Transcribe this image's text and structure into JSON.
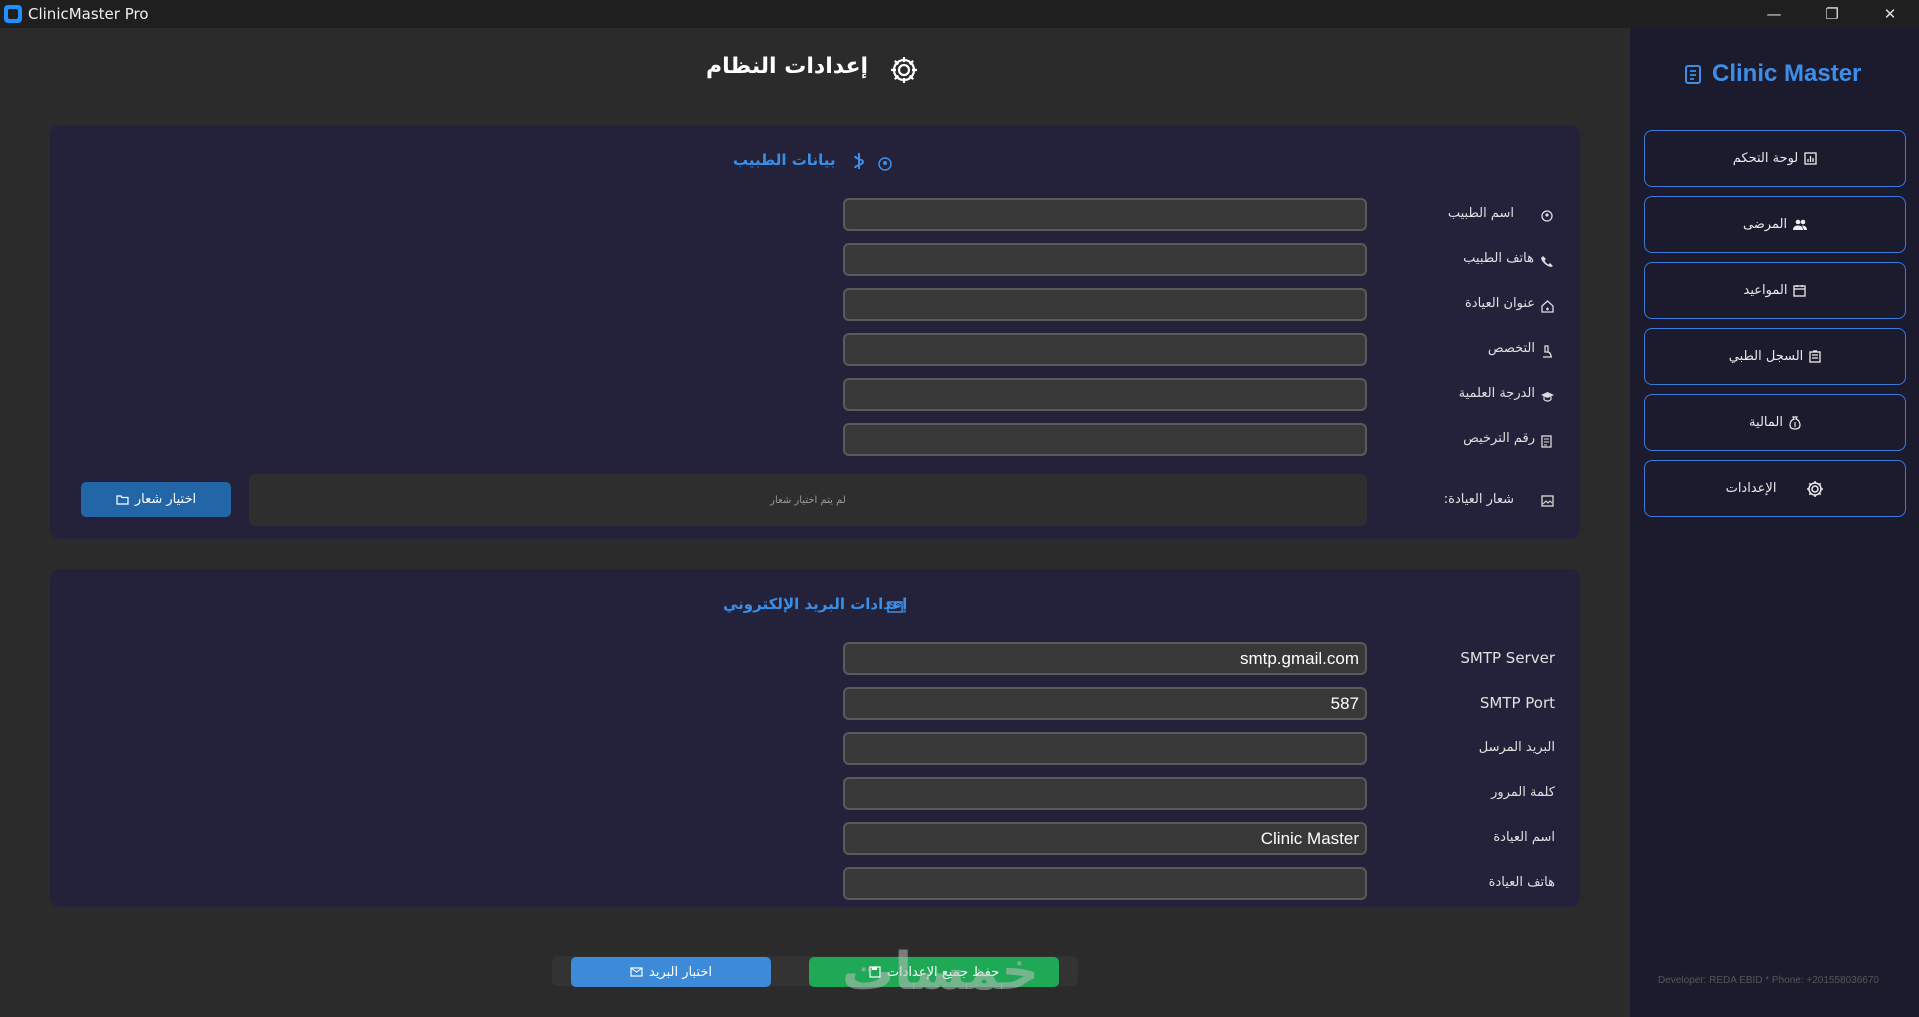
{
  "window": {
    "title": "ClinicMaster Pro",
    "controls": [
      "—",
      "❐",
      "✕"
    ]
  },
  "page": {
    "title": "إعدادات النظام",
    "icon": "gear-icon"
  },
  "doctor_section": {
    "title": "بيانات الطبيب",
    "fields": [
      {
        "label": "اسم الطبيب",
        "icon": "doctor-icon",
        "value": ""
      },
      {
        "label": "هاتف الطبيب",
        "icon": "phone-icon",
        "value": ""
      },
      {
        "label": "عنوان العيادة",
        "icon": "clinic-icon",
        "value": ""
      },
      {
        "label": "التخصص",
        "icon": "microscope-icon",
        "value": ""
      },
      {
        "label": "الدرجة العلمية",
        "icon": "graduation-cap-icon",
        "value": ""
      },
      {
        "label": "رقم الترخيص",
        "icon": "license-icon",
        "value": ""
      }
    ],
    "logo_label": "شعار العيادة:",
    "logo_status": "لم يتم اختيار شعار",
    "logo_button": "اختيار شعار"
  },
  "email_section": {
    "title": "إعدادات البريد الإلكتروني",
    "fields": [
      {
        "label": "SMTP Server",
        "value": "smtp.gmail.com"
      },
      {
        "label": "SMTP Port",
        "value": "587"
      },
      {
        "label": "البريد المرسل",
        "value": ""
      },
      {
        "label": "كلمة المرور",
        "value": ""
      },
      {
        "label": "اسم العيادة",
        "value": "Clinic Master"
      },
      {
        "label": "هاتف العيادة",
        "value": ""
      }
    ]
  },
  "footer": {
    "test_button": "اختبار البريد",
    "save_button": "حفظ جميع الإعدادات",
    "watermark": "خمسات"
  },
  "sidebar": {
    "brand": "Clinic Master",
    "items": [
      {
        "label": "لوحة التحكم",
        "icon": "dashboard-icon"
      },
      {
        "label": "المرضى",
        "icon": "users-icon"
      },
      {
        "label": "المواعيد",
        "icon": "calendar-icon"
      },
      {
        "label": "السجل الطبي",
        "icon": "clipboard-icon"
      },
      {
        "label": "المالية",
        "icon": "money-bag-icon"
      },
      {
        "label": "الإعدادات",
        "icon": "gear-icon"
      }
    ],
    "developer": "Developer: REDA EBID * Phone: +201558036670"
  },
  "colors": {
    "accent": "#3d8ee8",
    "save": "#1fa855",
    "card": "#23223a",
    "sidebar": "#1c1b2e"
  }
}
